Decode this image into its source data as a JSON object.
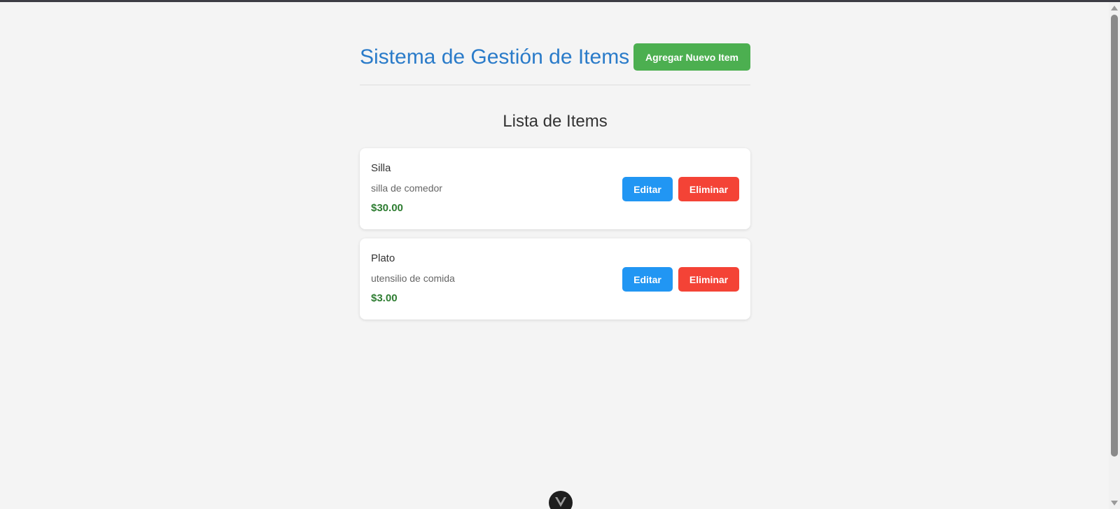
{
  "header": {
    "title": "Sistema de Gestión de Items",
    "add_button_label": "Agregar Nuevo Item"
  },
  "list": {
    "title": "Lista de Items",
    "edit_label": "Editar",
    "delete_label": "Eliminar",
    "items": [
      {
        "name": "Silla",
        "description": "silla de comedor",
        "price": "$30.00"
      },
      {
        "name": "Plato",
        "description": "utensilio de comida",
        "price": "$3.00"
      }
    ]
  },
  "colors": {
    "title": "#2a7bc9",
    "add_button": "#4caf50",
    "edit_button": "#2196f3",
    "delete_button": "#f44336",
    "price": "#2e7d32",
    "background": "#f4f4f4"
  },
  "icons": {
    "devtools_toggle": "vue-logo-icon"
  }
}
